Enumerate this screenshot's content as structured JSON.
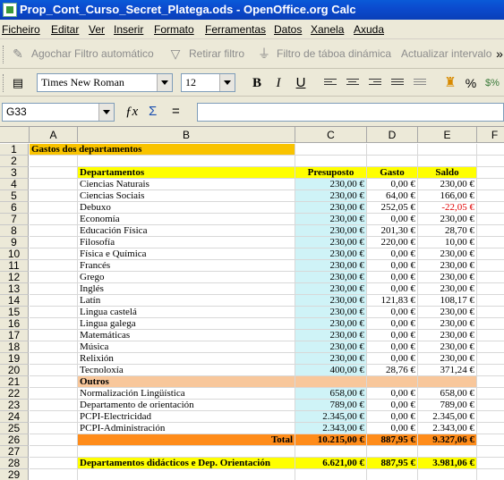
{
  "window": {
    "title": "Prop_Cont_Curso_Secret_Platega.ods - OpenOffice.org Calc"
  },
  "menu": [
    "Ficheiro",
    "Editar",
    "Ver",
    "Inserir",
    "Formato",
    "Ferramentas",
    "Datos",
    "Xanela",
    "Axuda"
  ],
  "toolbar1": {
    "autofilter": "Agochar Filtro automático",
    "remove_filter": "Retirar filtro",
    "pivot_filter": "Filtro de táboa dinámica",
    "refresh_range": "Actualizar intervalo"
  },
  "toolbar2": {
    "font_name": "Times New Roman",
    "font_size": "12",
    "bold": "B",
    "italic": "I",
    "underline": "U",
    "percent": "%",
    "currency": "$%"
  },
  "formula_bar": {
    "cell_ref": "G33",
    "content": ""
  },
  "columns": [
    "A",
    "B",
    "C",
    "D",
    "E",
    "F"
  ],
  "rows": [
    "1",
    "2",
    "3",
    "4",
    "5",
    "6",
    "7",
    "8",
    "9",
    "10",
    "11",
    "12",
    "13",
    "14",
    "15",
    "16",
    "17",
    "18",
    "19",
    "20",
    "21",
    "22",
    "23",
    "24",
    "25",
    "26",
    "27",
    "28",
    "29"
  ],
  "sheet": {
    "title": "Gastos dos departamentos",
    "headers": [
      "Departamentos",
      "Presuposto",
      "Gasto",
      "Saldo"
    ],
    "departments": [
      [
        "Ciencias Naturais",
        "230,00 €",
        "0,00 €",
        "230,00 €"
      ],
      [
        "Ciencias Sociais",
        "230,00 €",
        "64,00 €",
        "166,00 €"
      ],
      [
        "Debuxo",
        "230,00 €",
        "252,05 €",
        "-22,05 €"
      ],
      [
        "Economía",
        "230,00 €",
        "0,00 €",
        "230,00 €"
      ],
      [
        "Educación Física",
        "230,00 €",
        "201,30 €",
        "28,70 €"
      ],
      [
        "Filosofía",
        "230,00 €",
        "220,00 €",
        "10,00 €"
      ],
      [
        "Física e Química",
        "230,00 €",
        "0,00 €",
        "230,00 €"
      ],
      [
        "Francés",
        "230,00 €",
        "0,00 €",
        "230,00 €"
      ],
      [
        "Grego",
        "230,00 €",
        "0,00 €",
        "230,00 €"
      ],
      [
        "Inglés",
        "230,00 €",
        "0,00 €",
        "230,00 €"
      ],
      [
        "Latín",
        "230,00 €",
        "121,83 €",
        "108,17 €"
      ],
      [
        "Lingua castelá",
        "230,00 €",
        "0,00 €",
        "230,00 €"
      ],
      [
        "Lingua galega",
        "230,00 €",
        "0,00 €",
        "230,00 €"
      ],
      [
        "Matemáticas",
        "230,00 €",
        "0,00 €",
        "230,00 €"
      ],
      [
        "Música",
        "230,00 €",
        "0,00 €",
        "230,00 €"
      ],
      [
        "Relixión",
        "230,00 €",
        "0,00 €",
        "230,00 €"
      ],
      [
        "Tecnoloxía",
        "400,00 €",
        "28,76 €",
        "371,24 €"
      ]
    ],
    "others_label": "Outros",
    "others": [
      [
        "Normalización Lingüística",
        "658,00 €",
        "0,00 €",
        "658,00 €"
      ],
      [
        "Departamento de orientación",
        "789,00 €",
        "0,00 €",
        "789,00 €"
      ],
      [
        "PCPI-Electricidad",
        "2.345,00 €",
        "0,00 €",
        "2.345,00 €"
      ],
      [
        "PCPI-Administración",
        "2.343,00 €",
        "0,00 €",
        "2.343,00 €"
      ]
    ],
    "total": [
      "Total",
      "10.215,00 €",
      "887,95 €",
      "9.327,06 €"
    ],
    "summary": [
      "Departamentos didácticos e Dep. Orientación",
      "6.621,00 €",
      "887,95 €",
      "3.981,06 €"
    ]
  },
  "colors": {
    "title_bg": "#f9c300",
    "header_bg": "#ffff00",
    "budget_bg": "#cff3f7",
    "others_bg": "#f8c79b",
    "total_bg": "#ff8c1a",
    "summary_bg": "#ffff00",
    "negative": "#e00000"
  }
}
